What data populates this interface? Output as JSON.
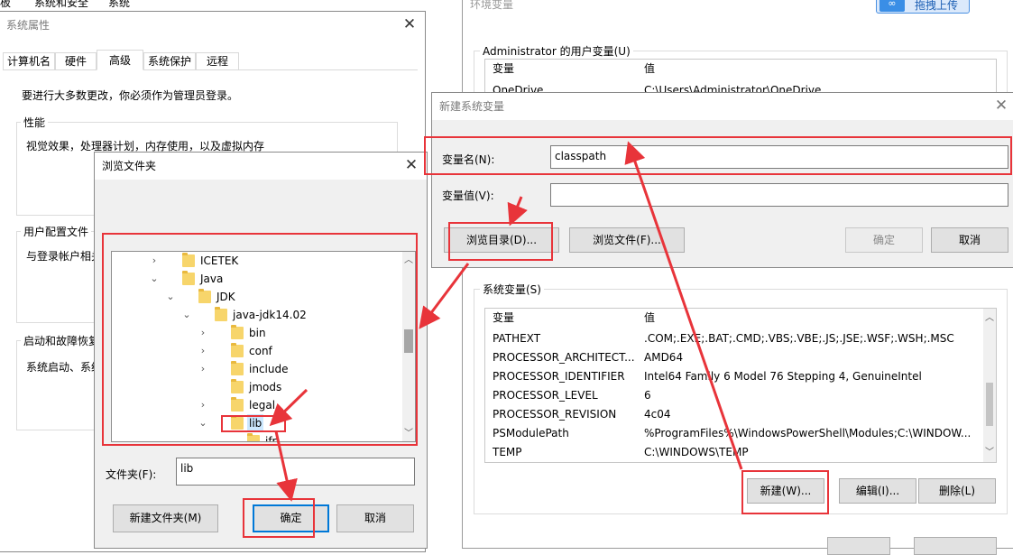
{
  "background_window": {
    "breadcrumb": [
      "板",
      "系统和安全",
      "系统"
    ],
    "env_title": "环境变量",
    "upload_button": "拖拽上传"
  },
  "sys_props": {
    "title": "系统属性",
    "tabs": [
      "计算机名",
      "硬件",
      "高级",
      "系统保护",
      "远程"
    ],
    "active_tab": "高级",
    "admin_note": "要进行大多数更改，你必须作为管理员登录。",
    "perf_label": "性能",
    "perf_desc": "视觉效果，处理器计划，内存使用，以及虚拟内存",
    "profile_label": "用户配置文件",
    "profile_desc": "与登录帐户相关",
    "startup_label": "启动和故障恢复",
    "startup_desc": "系统启动、系统"
  },
  "browse": {
    "title": "浏览文件夹",
    "tree": [
      {
        "label": "ICETEK",
        "chev": "›"
      },
      {
        "label": "Java",
        "chev": "⌄"
      },
      {
        "label": "JDK",
        "chev": "⌄"
      },
      {
        "label": "java-jdk14.02",
        "chev": "⌄"
      },
      {
        "label": "bin",
        "chev": "›"
      },
      {
        "label": "conf",
        "chev": "›"
      },
      {
        "label": "include",
        "chev": "›"
      },
      {
        "label": "jmods",
        "chev": ""
      },
      {
        "label": "legal",
        "chev": "›"
      },
      {
        "label": "lib",
        "chev": "⌄"
      },
      {
        "label": "jfr",
        "chev": ""
      }
    ],
    "folder_label": "文件夹(F):",
    "folder_value": "lib",
    "new_folder_button": "新建文件夹(M)",
    "ok_button": "确定",
    "cancel_button": "取消"
  },
  "env": {
    "user_group_label": "Administrator 的用户变量(U)",
    "user_headers": [
      "变量",
      "值"
    ],
    "user_rows": [
      [
        "OneDrive",
        "C:\\Users\\Administrator\\OneDrive"
      ]
    ],
    "sys_group_label": "系统变量(S)",
    "sys_headers": [
      "变量",
      "值"
    ],
    "sys_rows": [
      [
        "PATHEXT",
        ".COM;.EXE;.BAT;.CMD;.VBS;.VBE;.JS;.JSE;.WSF;.WSH;.MSC"
      ],
      [
        "PROCESSOR_ARCHITECT...",
        "AMD64"
      ],
      [
        "PROCESSOR_IDENTIFIER",
        "Intel64 Family 6 Model 76 Stepping 4, GenuineIntel"
      ],
      [
        "PROCESSOR_LEVEL",
        "6"
      ],
      [
        "PROCESSOR_REVISION",
        "4c04"
      ],
      [
        "PSModulePath",
        "%ProgramFiles%\\WindowsPowerShell\\Modules;C:\\WINDOW..."
      ],
      [
        "TEMP",
        "C:\\WINDOWS\\TEMP"
      ]
    ],
    "new_button": "新建(W)...",
    "edit_button": "编辑(I)...",
    "delete_button": "删除(L)"
  },
  "new_var": {
    "title": "新建系统变量",
    "name_label": "变量名(N):",
    "name_value": "classpath",
    "value_label": "变量值(V):",
    "value_value": "",
    "browse_dir_button": "浏览目录(D)...",
    "browse_file_button": "浏览文件(F)...",
    "ok_button": "确定",
    "cancel_button": "取消"
  },
  "colors": {
    "annotation": "#e8343a",
    "accent": "#0078d7"
  }
}
